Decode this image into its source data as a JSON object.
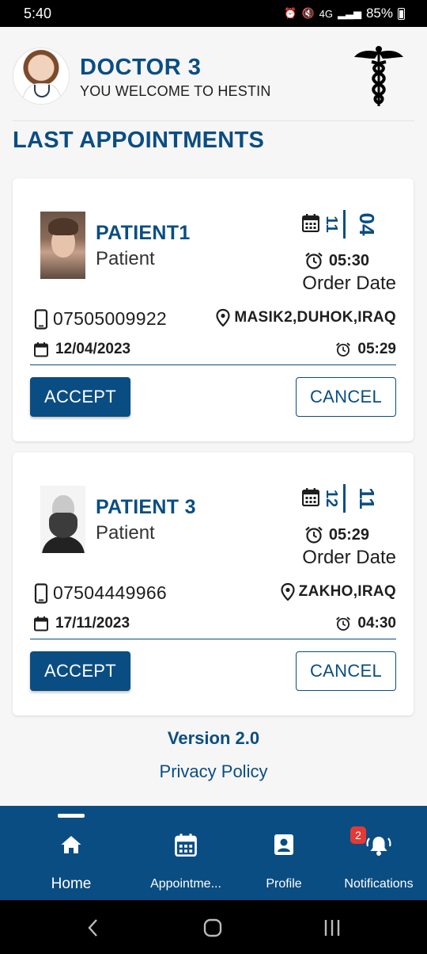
{
  "status_bar": {
    "time": "5:40",
    "network": "4G",
    "battery": "85%"
  },
  "header": {
    "doctor_name": "DOCTOR 3",
    "welcome": "YOU WELCOME TO HESTIN",
    "logo_icon": "caduceus-icon"
  },
  "section_title": "LAST APPOINTMENTS",
  "appointments": [
    {
      "patient_name": "PATIENT1",
      "role": "Patient",
      "order_month": "11",
      "order_day": "04",
      "order_time": "05:30",
      "order_label": "Order Date",
      "phone": "07505009922",
      "location": "MASIK2,DUHOK,IRAQ",
      "appointment_date": "12/04/2023",
      "appointment_time": "05:29",
      "accept_label": "ACCEPT",
      "cancel_label": "CANCEL"
    },
    {
      "patient_name": "PATIENT 3",
      "role": "Patient",
      "order_month": "12",
      "order_day": "11",
      "order_time": "05:29",
      "order_label": "Order Date",
      "phone": "07504449966",
      "location": "ZAKHO,IRAQ",
      "appointment_date": "17/11/2023",
      "appointment_time": "04:30",
      "accept_label": "ACCEPT",
      "cancel_label": "CANCEL"
    }
  ],
  "footer": {
    "version": "Version 2.0",
    "privacy": "Privacy Policy"
  },
  "bottom_nav": {
    "home": "Home",
    "appointments": "Appointme...",
    "profile": "Profile",
    "notifications": "Notifications",
    "notifications_badge": "2",
    "active": "Home"
  },
  "colors": {
    "primary": "#0a4d82",
    "badge": "#e53935"
  }
}
